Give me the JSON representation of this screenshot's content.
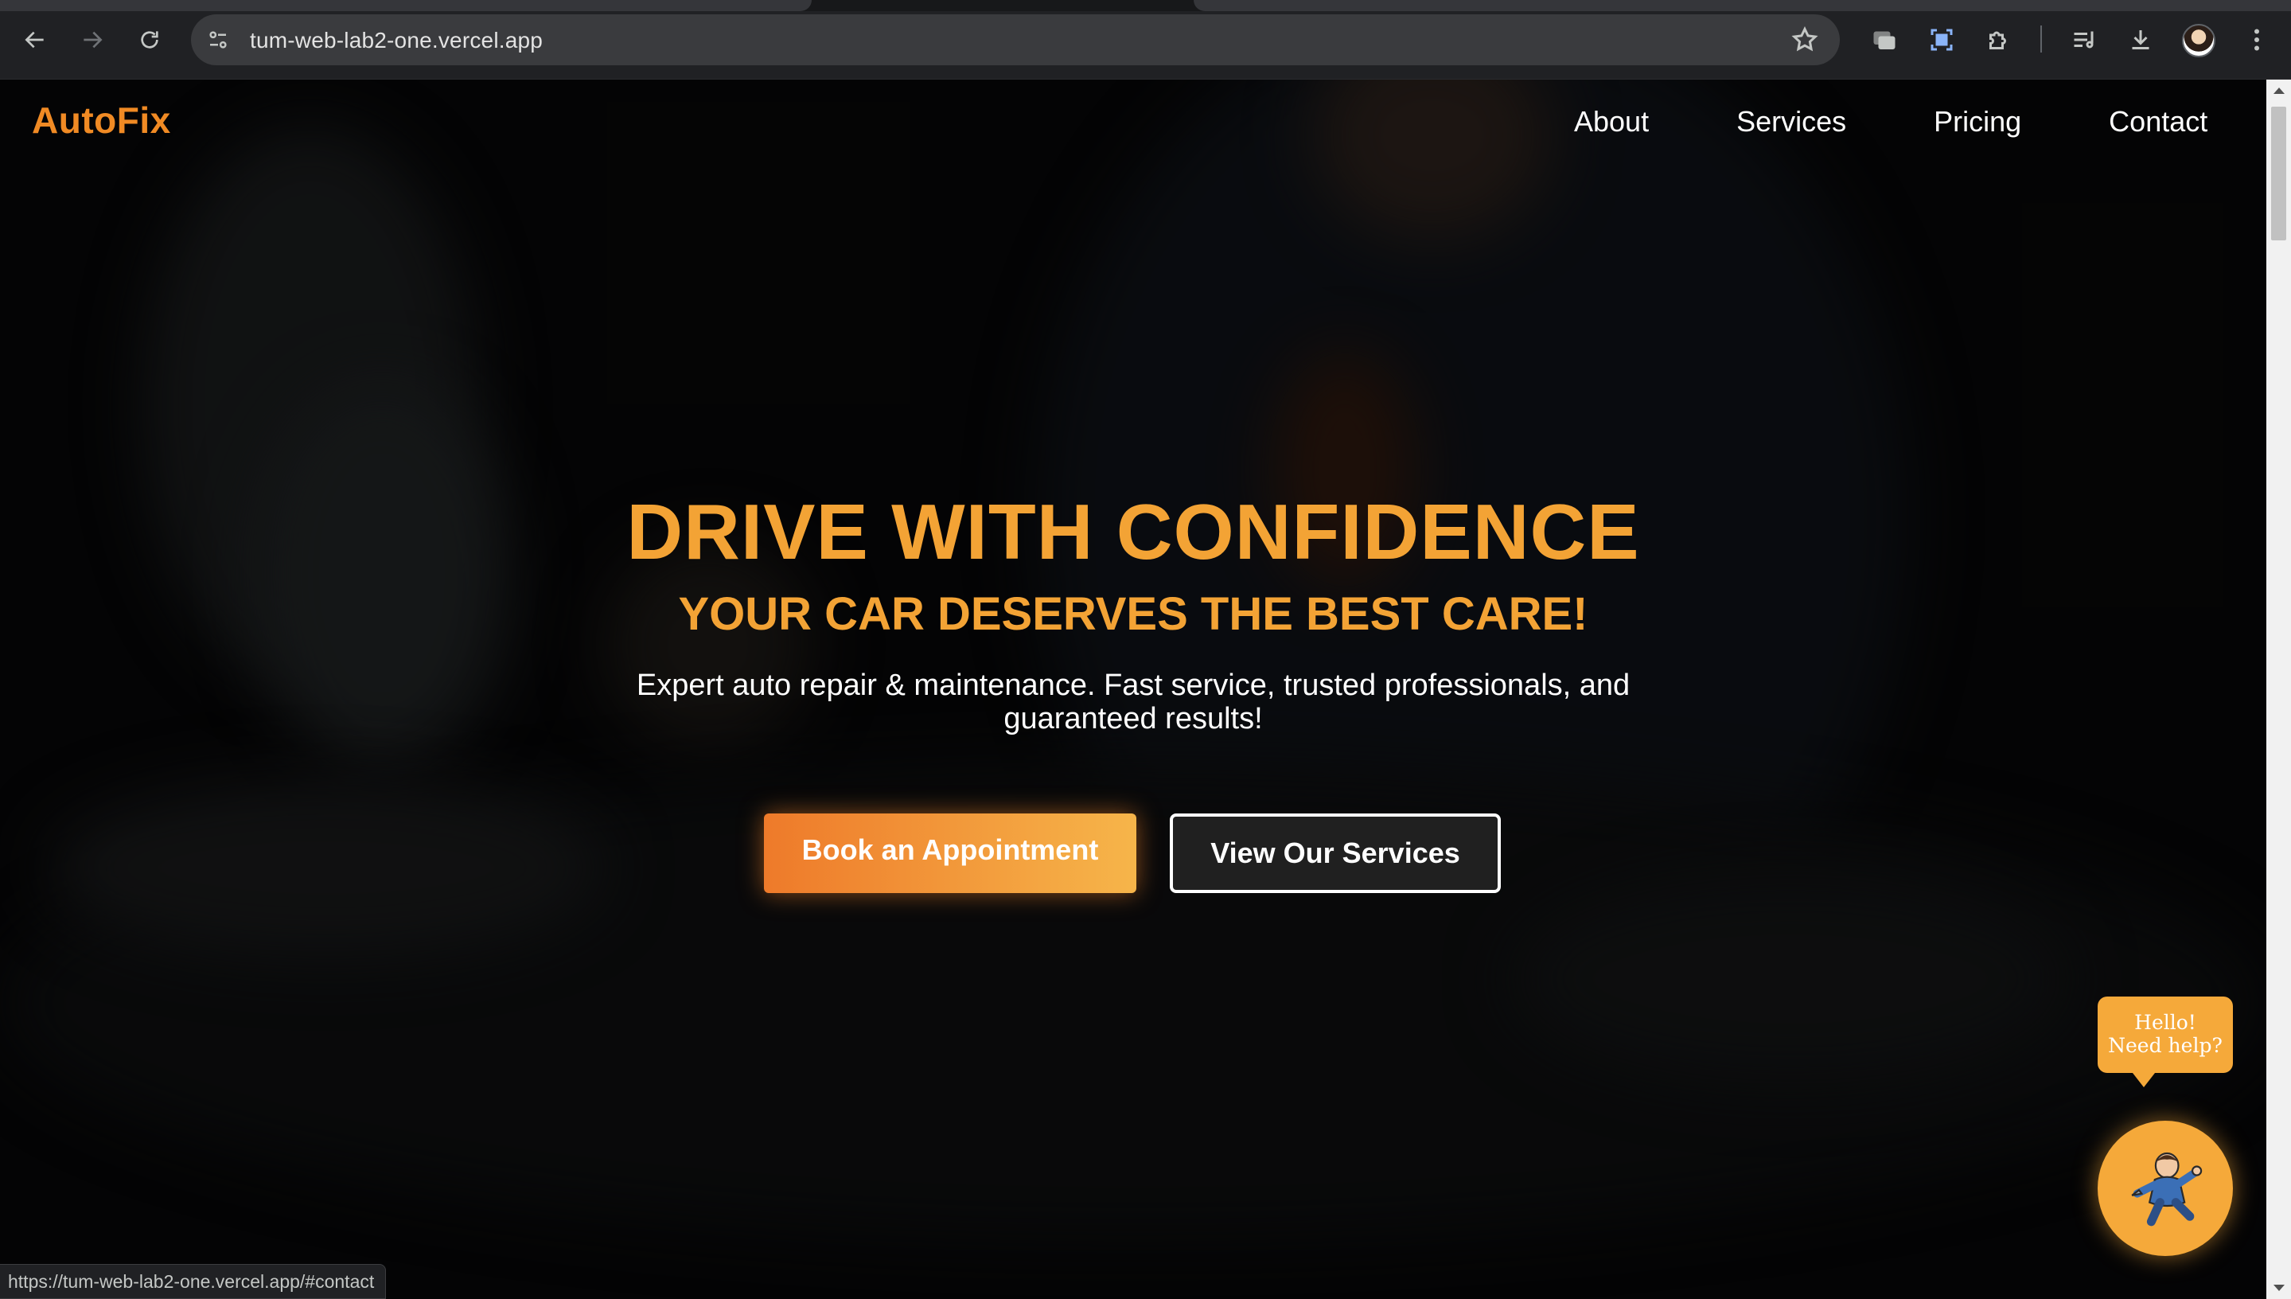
{
  "browser": {
    "url": "tum-web-lab2-one.vercel.app",
    "status_url": "https://tum-web-lab2-one.vercel.app/#contact"
  },
  "site": {
    "logo": "AutoFix",
    "nav": [
      "About",
      "Services",
      "Pricing",
      "Contact"
    ]
  },
  "hero": {
    "title": "DRIVE WITH CONFIDENCE",
    "subtitle": "YOUR CAR DESERVES THE BEST CARE!",
    "description": "Expert auto repair & maintenance. Fast service, trusted professionals, and guaranteed results!",
    "primary_button": "Book an Appointment",
    "secondary_button": "View Our Services"
  },
  "chat": {
    "bubble_line1": "Hello!",
    "bubble_line2": "Need help?"
  },
  "colors": {
    "accent": "#f3a335",
    "logo": "#f08a24",
    "chrome": "#202124"
  }
}
